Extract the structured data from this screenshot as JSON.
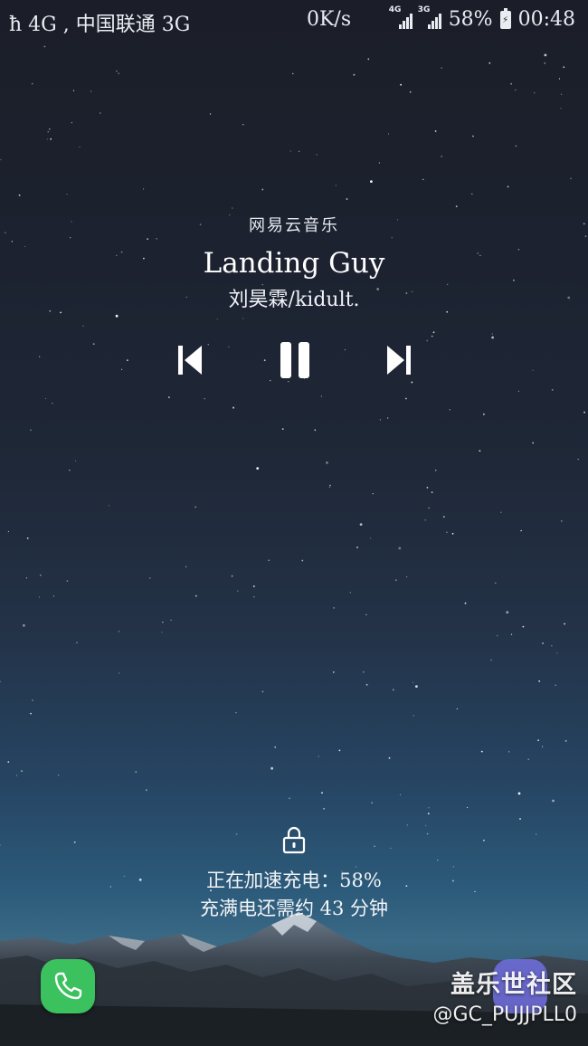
{
  "status_bar": {
    "left_text": "ħ 4G , 中国联通 3G",
    "net_speed": "0K/s",
    "signal1_label": "4G",
    "signal2_label": "3G",
    "battery_percent": "58%",
    "time": "00:48",
    "icons": [
      "signal-4g-icon",
      "signal-3g-icon",
      "battery-charging-icon"
    ]
  },
  "music": {
    "app_name": "网易云音乐",
    "title": "Landing Guy",
    "artist": "刘昊霖/kidult.",
    "controls": [
      "previous-icon",
      "pause-icon",
      "next-icon"
    ]
  },
  "lockscreen": {
    "lock_icon": "lock-icon",
    "charging_line1": "正在加速充电：58%",
    "charging_line2": "充满电还需约 43 分钟"
  },
  "shortcuts": {
    "left": "phone-icon",
    "right": "camera-icon"
  },
  "watermark": {
    "logo": "盖乐世社区",
    "user": "@GC_PUJJPLL0"
  },
  "colors": {
    "phone_green": "#3cc15f",
    "camera_purple": "#6e6cd8",
    "sky_top": "#1b1e28",
    "sky_bottom": "#2c5a7a"
  }
}
